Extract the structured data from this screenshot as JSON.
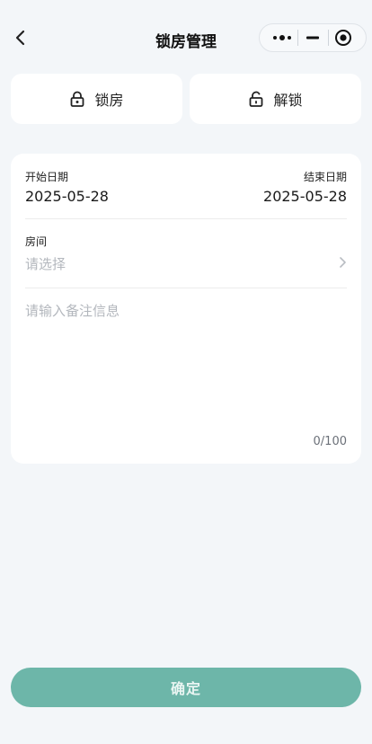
{
  "header": {
    "title": "锁房管理",
    "back_icon": "chevron-left-icon",
    "capsule": {
      "more_icon": "more-dots-icon",
      "minimize_icon": "minimize-icon",
      "close_icon": "target-close-icon"
    }
  },
  "actions": [
    {
      "label": "锁房",
      "icon": "lock-closed-icon"
    },
    {
      "label": "解锁",
      "icon": "lock-open-icon"
    }
  ],
  "form": {
    "start_label": "开始日期",
    "start_value": "2025-05-28",
    "end_label": "结束日期",
    "end_value": "2025-05-28",
    "room_label": "房间",
    "room_placeholder": "请选择",
    "note_placeholder": "请输入备注信息",
    "note_value": "",
    "counter": "0/100"
  },
  "confirm_label": "确定",
  "colors": {
    "primary": "#6db6a9",
    "background": "#f3f6f9",
    "placeholder": "#b3b7bd"
  }
}
